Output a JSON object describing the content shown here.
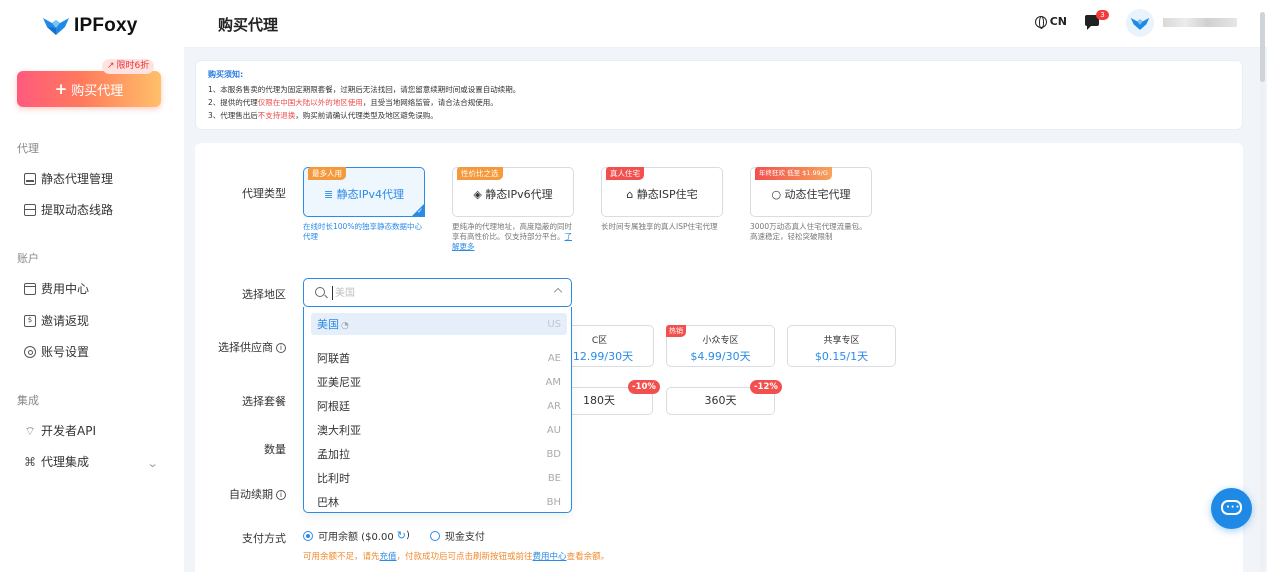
{
  "brand": {
    "name": "IPFoxy"
  },
  "sidebar": {
    "buy_button": "购买代理",
    "promo_badge": "限时6折",
    "sections": [
      {
        "title": "代理",
        "items": [
          "静态代理管理",
          "提取动态线路"
        ]
      },
      {
        "title": "账户",
        "items": [
          "费用中心",
          "邀请返现",
          "账号设置"
        ]
      },
      {
        "title": "集成",
        "items": [
          "开发者API",
          "代理集成"
        ]
      }
    ]
  },
  "header": {
    "title": "购买代理",
    "language": "CN",
    "message_count": "3"
  },
  "notice": {
    "title": "购买须知:",
    "line1": "1、本服务售卖的代理为固定期限套餐，过期后无法找回，请您留意续期时间或设置自动续期。",
    "line2_a": "2、提供的代理",
    "line2_red": "仅限在中国大陆以外的地区使用",
    "line2_b": "，且受当地网络监管，请合法合规使用。",
    "line3_a": "3、代理售出后",
    "line3_red": "不支持退换",
    "line3_b": "，购买前请确认代理类型及地区避免误购。"
  },
  "form": {
    "labels": {
      "proxy_type": "代理类型",
      "region": "选择地区",
      "supplier": "选择供应商",
      "plan": "选择套餐",
      "quantity": "数量",
      "auto_renew": "自动续期",
      "payment": "支付方式"
    },
    "proxy_types": [
      {
        "tag": "最多人用",
        "name": "静态IPv4代理",
        "desc": "在线时长100%的独享静态数据中心代理"
      },
      {
        "tag": "性价比之选",
        "name": "静态IPv6代理",
        "desc": "更纯净的代理地址，高度隐蔽的同时享有高性价比。仅支持部分平台。",
        "link": "了解更多"
      },
      {
        "tag": "真人住宅",
        "name": "静态ISP住宅",
        "desc": "长时间专属独享的真人ISP住宅代理"
      },
      {
        "tag": "年终狂欢 低至 $1.99/G",
        "name": "动态住宅代理",
        "desc": "3000万动态真人住宅代理流量包。高速稳定，轻松突破限制"
      }
    ],
    "region_search": {
      "placeholder": "美国"
    },
    "region_options": [
      {
        "name": "美国",
        "code": "US",
        "selected": true
      },
      {
        "name": "阿联酋",
        "code": "AE"
      },
      {
        "name": "亚美尼亚",
        "code": "AM"
      },
      {
        "name": "阿根廷",
        "code": "AR"
      },
      {
        "name": "澳大利亚",
        "code": "AU"
      },
      {
        "name": "孟加拉",
        "code": "BD"
      },
      {
        "name": "比利时",
        "code": "BE"
      },
      {
        "name": "巴林",
        "code": "BH"
      }
    ],
    "suppliers": [
      {
        "name": "C区",
        "price": "$12.99/30天"
      },
      {
        "name": "小众专区",
        "price": "$4.99/30天",
        "hot": "热销"
      },
      {
        "name": "共享专区",
        "price": "$0.15/1天"
      }
    ],
    "plans": [
      {
        "name": "180天",
        "discount": "-10%"
      },
      {
        "name": "360天",
        "discount": "-12%"
      }
    ],
    "payment": {
      "balance": "可用余额 ($0.00",
      "balance_close": ")",
      "cash": "现金支付",
      "note_a": "可用余额不足，请先",
      "note_link1": "充值",
      "note_b": "，付款成功后可点击刷新按钮或前往",
      "note_link2": "费用中心",
      "note_c": "查看余额。"
    }
  },
  "colors": {
    "accent": "#2a8be8",
    "danger": "#f2504e",
    "promo_orange": "#ff7a5c"
  }
}
